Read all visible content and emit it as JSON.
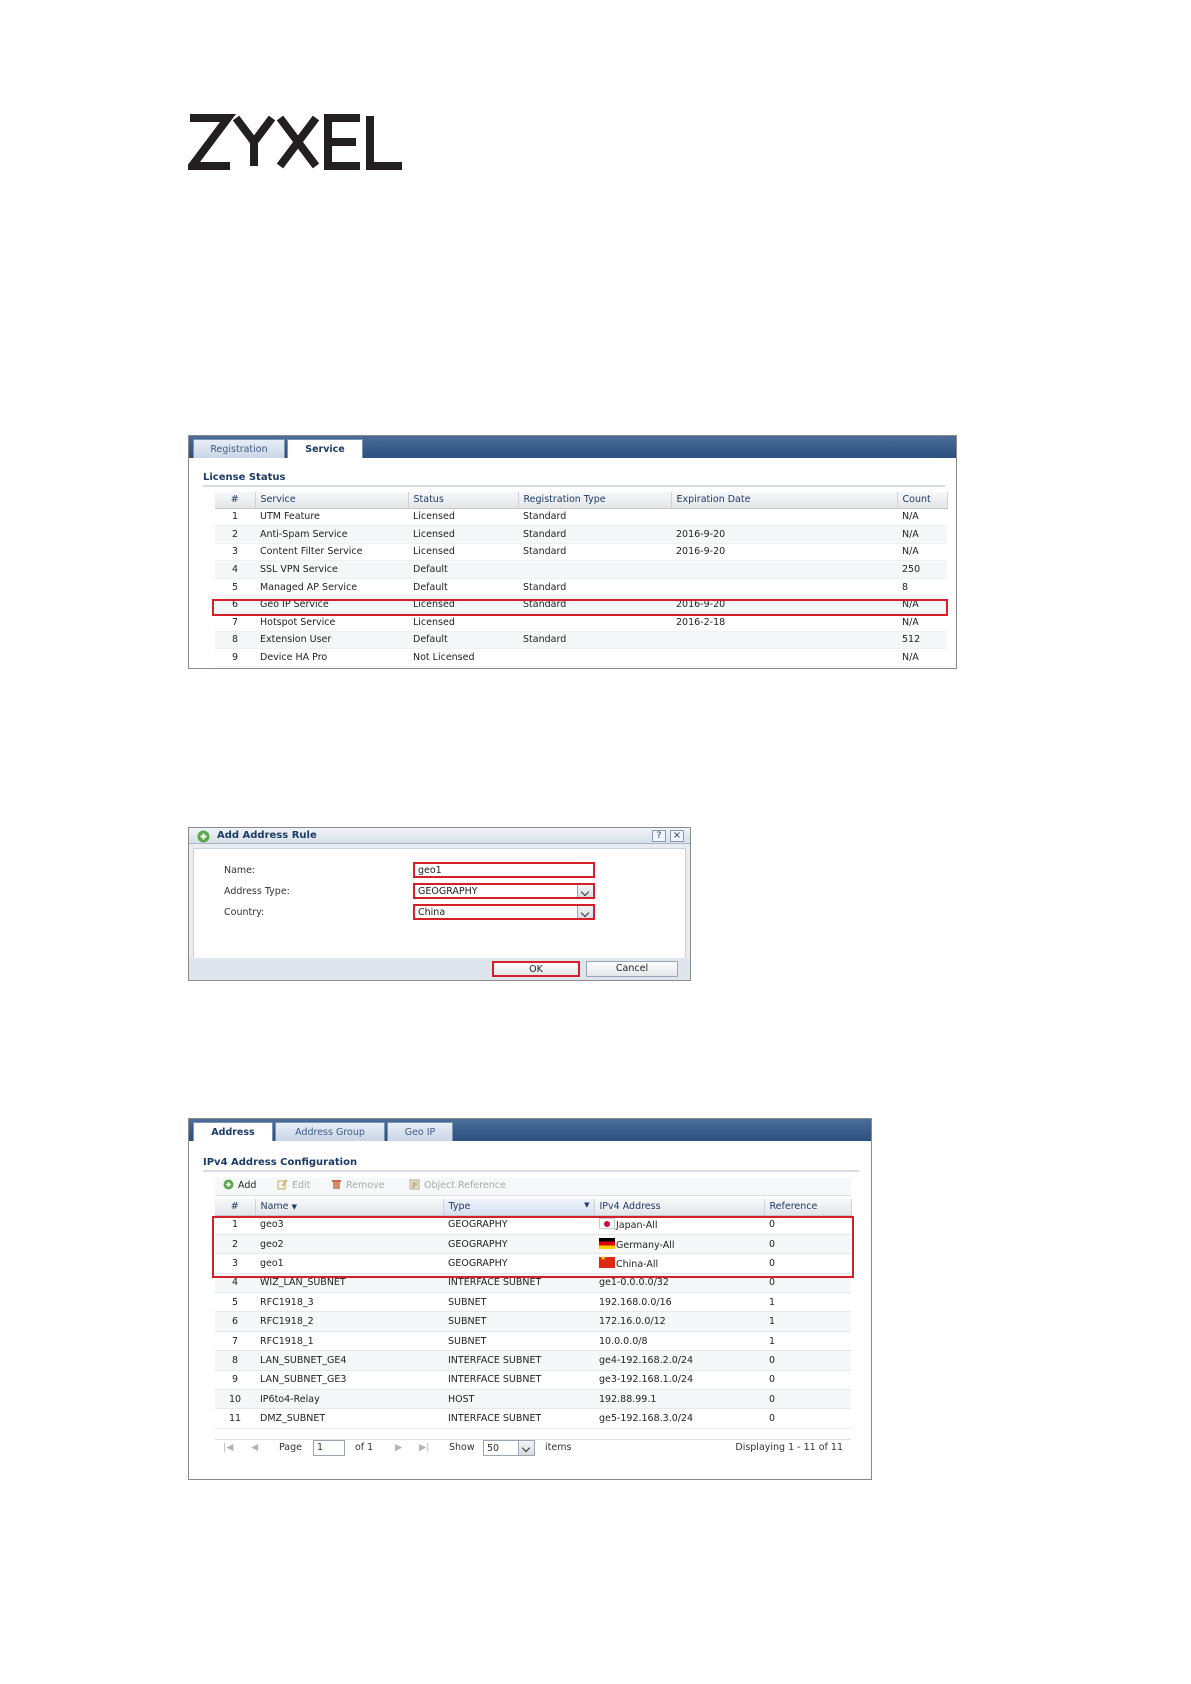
{
  "logo": {
    "text": "ZYXEL",
    "color": "#231f20"
  },
  "license_panel": {
    "tabs": [
      {
        "label": "Registration",
        "active": false
      },
      {
        "label": "Service",
        "active": true
      }
    ],
    "section_title": "License Status",
    "columns": [
      "#",
      "Service",
      "Status",
      "Registration Type",
      "Expiration Date",
      "Count"
    ],
    "rows": [
      {
        "num": "1",
        "service": "UTM Feature",
        "status": "Licensed",
        "reg_type": "Standard",
        "exp": "",
        "count": "N/A"
      },
      {
        "num": "2",
        "service": "Anti-Spam Service",
        "status": "Licensed",
        "reg_type": "Standard",
        "exp": "2016-9-20",
        "count": "N/A"
      },
      {
        "num": "3",
        "service": "Content Filter Service",
        "status": "Licensed",
        "reg_type": "Standard",
        "exp": "2016-9-20",
        "count": "N/A"
      },
      {
        "num": "4",
        "service": "SSL VPN Service",
        "status": "Default",
        "reg_type": "",
        "exp": "",
        "count": "250"
      },
      {
        "num": "5",
        "service": "Managed AP Service",
        "status": "Default",
        "reg_type": "Standard",
        "exp": "",
        "count": "8"
      },
      {
        "num": "6",
        "service": "Geo IP Service",
        "status": "Licensed",
        "reg_type": "Standard",
        "exp": "2016-9-20",
        "count": "N/A"
      },
      {
        "num": "7",
        "service": "Hotspot Service",
        "status": "Licensed",
        "reg_type": "",
        "exp": "2016-2-18",
        "count": "N/A"
      },
      {
        "num": "8",
        "service": "Extension User",
        "status": "Default",
        "reg_type": "Standard",
        "exp": "",
        "count": "512"
      },
      {
        "num": "9",
        "service": "Device HA Pro",
        "status": "Not Licensed",
        "reg_type": "",
        "exp": "",
        "count": "N/A"
      }
    ],
    "highlighted_row": "6"
  },
  "dialog": {
    "title": "Add Address Rule",
    "help_icon": "help-icon",
    "close_icon": "close-icon",
    "fields": {
      "name_label": "Name:",
      "name_value": "geo1",
      "type_label": "Address Type:",
      "type_value": "GEOGRAPHY",
      "country_label": "Country:",
      "country_value": "China"
    },
    "ok_label": "OK",
    "cancel_label": "Cancel"
  },
  "address_panel": {
    "tabs": [
      {
        "label": "Address",
        "active": true
      },
      {
        "label": "Address Group",
        "active": false
      },
      {
        "label": "Geo IP",
        "active": false
      }
    ],
    "section_title": "IPv4 Address Configuration",
    "toolbar": {
      "add": "Add",
      "edit": "Edit",
      "remove": "Remove",
      "object_reference": "Object Reference"
    },
    "columns": [
      "#",
      "Name",
      "Type",
      "IPv4 Address",
      "Reference"
    ],
    "rows": [
      {
        "num": "1",
        "name": "geo3",
        "type": "GEOGRAPHY",
        "address": "Japan-All",
        "flag": "jp",
        "ref": "0"
      },
      {
        "num": "2",
        "name": "geo2",
        "type": "GEOGRAPHY",
        "address": "Germany-All",
        "flag": "de",
        "ref": "0"
      },
      {
        "num": "3",
        "name": "geo1",
        "type": "GEOGRAPHY",
        "address": "China-All",
        "flag": "cn",
        "ref": "0"
      },
      {
        "num": "4",
        "name": "WIZ_LAN_SUBNET",
        "type": "INTERFACE SUBNET",
        "address": "ge1-0.0.0.0/32",
        "flag": "",
        "ref": "0"
      },
      {
        "num": "5",
        "name": "RFC1918_3",
        "type": "SUBNET",
        "address": "192.168.0.0/16",
        "flag": "",
        "ref": "1"
      },
      {
        "num": "6",
        "name": "RFC1918_2",
        "type": "SUBNET",
        "address": "172.16.0.0/12",
        "flag": "",
        "ref": "1"
      },
      {
        "num": "7",
        "name": "RFC1918_1",
        "type": "SUBNET",
        "address": "10.0.0.0/8",
        "flag": "",
        "ref": "1"
      },
      {
        "num": "8",
        "name": "LAN_SUBNET_GE4",
        "type": "INTERFACE SUBNET",
        "address": "ge4-192.168.2.0/24",
        "flag": "",
        "ref": "0"
      },
      {
        "num": "9",
        "name": "LAN_SUBNET_GE3",
        "type": "INTERFACE SUBNET",
        "address": "ge3-192.168.1.0/24",
        "flag": "",
        "ref": "0"
      },
      {
        "num": "10",
        "name": "IP6to4-Relay",
        "type": "HOST",
        "address": "192.88.99.1",
        "flag": "",
        "ref": "0"
      },
      {
        "num": "11",
        "name": "DMZ_SUBNET",
        "type": "INTERFACE SUBNET",
        "address": "ge5-192.168.3.0/24",
        "flag": "",
        "ref": "0"
      }
    ],
    "highlighted_rows": [
      "1",
      "2",
      "3"
    ],
    "pager": {
      "page_label": "Page",
      "page_value": "1",
      "of_label": "of 1",
      "show_label": "Show",
      "show_value": "50",
      "items_label": "items",
      "displaying": "Displaying 1 - 11 of 11"
    }
  },
  "colors": {
    "highlight": "#d62029",
    "header_blue": "#2d4f7e",
    "title_text": "#1d3b66"
  }
}
